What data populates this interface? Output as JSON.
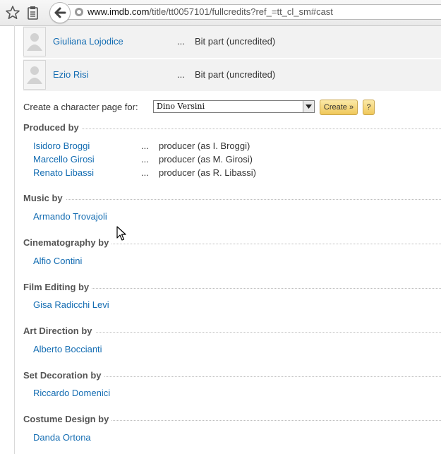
{
  "browser": {
    "url_host": "www.imdb.com",
    "url_path": "/title/tt0057101/fullcredits?ref_=tt_cl_sm#cast"
  },
  "cast": [
    {
      "name": "Giuliana Lojodice",
      "dots": "...",
      "role": "Bit part (uncredited)"
    },
    {
      "name": "Ezio Risi",
      "dots": "...",
      "role": "Bit part (uncredited)"
    }
  ],
  "character_page": {
    "label": "Create a character page for:",
    "selected": "Dino Versini",
    "create_label": "Create »",
    "help_label": "?"
  },
  "sections": {
    "produced_by": {
      "title": "Produced by",
      "rows": [
        {
          "name": "Isidoro Broggi",
          "dots": "...",
          "credit": "producer (as I. Broggi)"
        },
        {
          "name": "Marcello Girosi",
          "dots": "...",
          "credit": "producer (as M. Girosi)"
        },
        {
          "name": "Renato Libassi",
          "dots": "...",
          "credit": "producer (as R. Libassi)"
        }
      ]
    },
    "music_by": {
      "title": "Music by",
      "name": "Armando Trovajoli"
    },
    "cinematography_by": {
      "title": "Cinematography by",
      "name": "Alfio Contini"
    },
    "film_editing_by": {
      "title": "Film Editing by",
      "name": "Gisa Radicchi Levi"
    },
    "art_direction_by": {
      "title": "Art Direction by",
      "name": "Alberto Boccianti"
    },
    "set_decoration_by": {
      "title": "Set Decoration by",
      "name": "Riccardo Domenici"
    },
    "costume_design_by": {
      "title": "Costume Design by",
      "name": "Danda Ortona"
    }
  },
  "colors": {
    "link": "#136cb2",
    "button": "#f0c85a",
    "row_bg": "#f2f2f2"
  }
}
